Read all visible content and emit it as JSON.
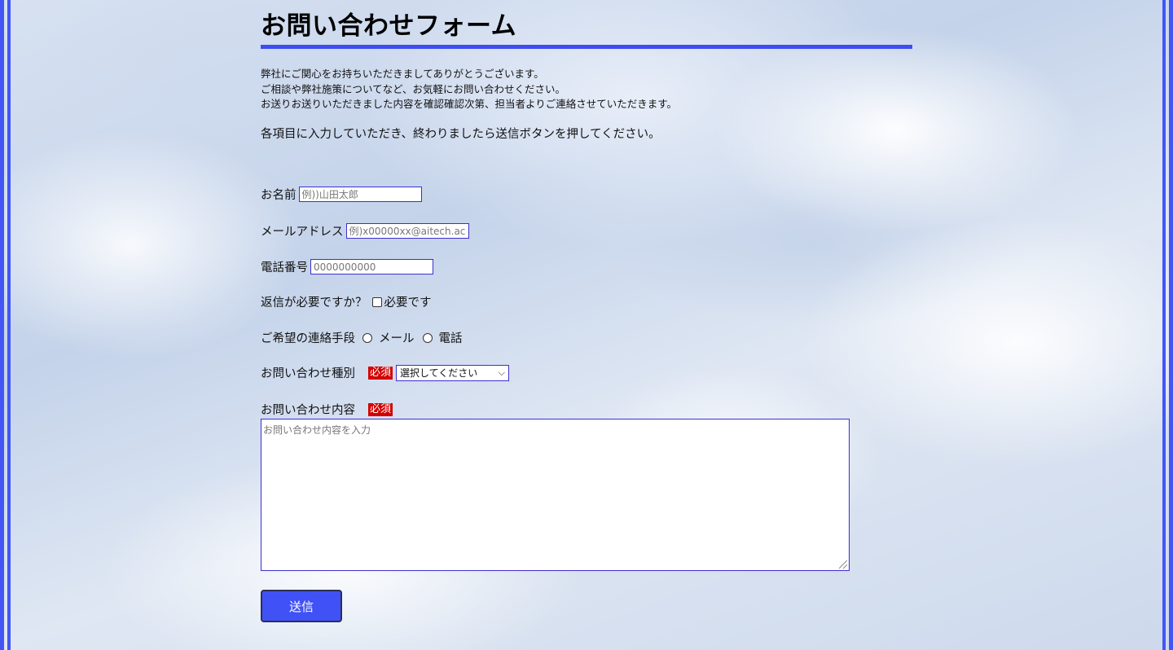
{
  "header": {
    "title": "お問い合わせフォーム"
  },
  "intro": {
    "lines": [
      "弊社にご関心をお持ちいただきましてありがとうございます。",
      "ご相談や弊社施策についてなど、お気軽にお問い合わせください。",
      "お送りお送りいただきました内容を確認確認次第、担当者よりご連絡させていただきます。"
    ],
    "instruction": "各項目に入力していただき、終わりましたら送信ボタンを押してください。"
  },
  "form": {
    "name": {
      "label": "お名前",
      "placeholder": "例))山田太郎",
      "value": ""
    },
    "email": {
      "label": "メールアドレス",
      "placeholder": "例)x00000xx@aitech.ac",
      "value": ""
    },
    "phone": {
      "label": "電話番号",
      "placeholder": "0000000000",
      "value": ""
    },
    "reply": {
      "label": "返信が必要ですか？",
      "checkbox_label": "必要です",
      "checked": false
    },
    "contact_method": {
      "label": "ご希望の連絡手段",
      "options": [
        "メール",
        "電話"
      ],
      "selected": ""
    },
    "inquiry_type": {
      "label": "お問い合わせ種別",
      "required_badge": "必須",
      "selected_text": "選択してください"
    },
    "inquiry_content": {
      "label": "お問い合わせ内容",
      "required_badge": "必須",
      "placeholder": "お問い合わせ内容を入力",
      "value": ""
    },
    "submit_label": "送信"
  },
  "colors": {
    "accent": "#4052f5",
    "required": "#d20000",
    "input_border": "#3d2fd0"
  }
}
